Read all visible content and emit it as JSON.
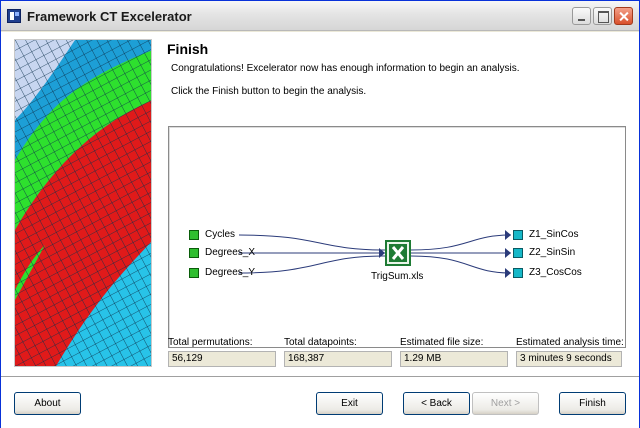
{
  "window": {
    "title": "Framework CT Excelerator"
  },
  "page": {
    "heading": "Finish",
    "message": "Congratulations! Excelerator now has enough information to begin an analysis.",
    "instruction": "Click the Finish button to begin the analysis."
  },
  "diagram": {
    "inputs": [
      "Cycles",
      "Degrees_X",
      "Degrees_Y"
    ],
    "workbook": "TrigSum.xls",
    "outputs": [
      "Z1_SinCos",
      "Z2_SinSin",
      "Z3_CosCos"
    ]
  },
  "stats": {
    "total_permutations": {
      "label": "Total permutations:",
      "value": "56,129"
    },
    "total_datapoints": {
      "label": "Total datapoints:",
      "value": "168,387"
    },
    "estimated_file_size": {
      "label": "Estimated file size:",
      "value": "1.29 MB"
    },
    "estimated_analysis_time": {
      "label": "Estimated analysis time:",
      "value": "3 minutes 9 seconds"
    }
  },
  "buttons": {
    "about": "About",
    "exit": "Exit",
    "back": "< Back",
    "next": "Next >",
    "finish": "Finish"
  },
  "colors": {
    "input_node": "#2fbf2f",
    "output_node": "#16b8c8",
    "excel_green": "#1e7b34",
    "link_color": "#2b3b7a"
  },
  "icons": {
    "app": "framework-ct-icon",
    "workbook": "excel-icon"
  }
}
